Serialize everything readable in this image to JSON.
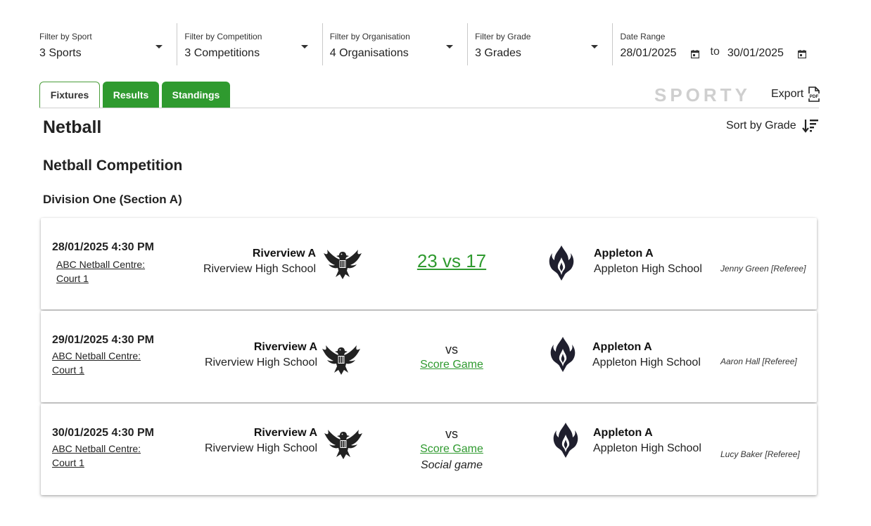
{
  "filters": {
    "sport": {
      "label": "Filter by Sport",
      "value": "3 Sports"
    },
    "competition": {
      "label": "Filter by Competition",
      "value": "3 Competitions"
    },
    "organisation": {
      "label": "Filter by Organisation",
      "value": "4 Organisations"
    },
    "grade": {
      "label": "Filter by Grade",
      "value": "3 Grades"
    },
    "date_range": {
      "label": "Date Range",
      "from": "28/01/2025",
      "to_label": "to",
      "to": "30/01/2025"
    }
  },
  "tabs": [
    {
      "label": "Fixtures",
      "active": true
    },
    {
      "label": "Results",
      "active": false
    },
    {
      "label": "Standings",
      "active": false
    }
  ],
  "brand": {
    "name": "SPORTY"
  },
  "toolbar": {
    "export_label": "Export",
    "sort_label": "Sort by Grade"
  },
  "colors": {
    "accent": "#2f9a2f",
    "text": "#222222"
  },
  "sport_title": "Netball",
  "competition_title": "Netball Competition",
  "division_title": "Division One (Section A)",
  "fixtures": [
    {
      "datetime": "28/01/2025 4:30 PM",
      "venue_line1": "ABC Netball Centre:",
      "venue_line2": "Court 1",
      "home_team": "Riverview A",
      "home_school": "Riverview High School",
      "home_logo": "eagle-icon",
      "score": "23 vs 17",
      "away_team": "Appleton A",
      "away_school": "Appleton High School",
      "away_logo": "flame-icon",
      "referee": "Jenny Green [Referee]"
    },
    {
      "datetime": "29/01/2025 4:30 PM",
      "venue_line1": "ABC Netball Centre:",
      "venue_line2": "Court 1",
      "home_team": "Riverview A",
      "home_school": "Riverview High School",
      "home_logo": "eagle-icon",
      "vs": "vs",
      "score_game": "Score Game",
      "away_team": "Appleton A",
      "away_school": "Appleton High School",
      "away_logo": "flame-icon",
      "referee": "Aaron Hall [Referee]"
    },
    {
      "datetime": "30/01/2025 4:30 PM",
      "venue_line1": "ABC Netball Centre:",
      "venue_line2": "Court 1",
      "home_team": "Riverview A",
      "home_school": "Riverview High School",
      "home_logo": "eagle-icon",
      "vs": "vs",
      "score_game": "Score Game",
      "note": "Social game",
      "away_team": "Appleton A",
      "away_school": "Appleton High School",
      "away_logo": "flame-icon",
      "referee": "Lucy Baker [Referee]"
    }
  ]
}
